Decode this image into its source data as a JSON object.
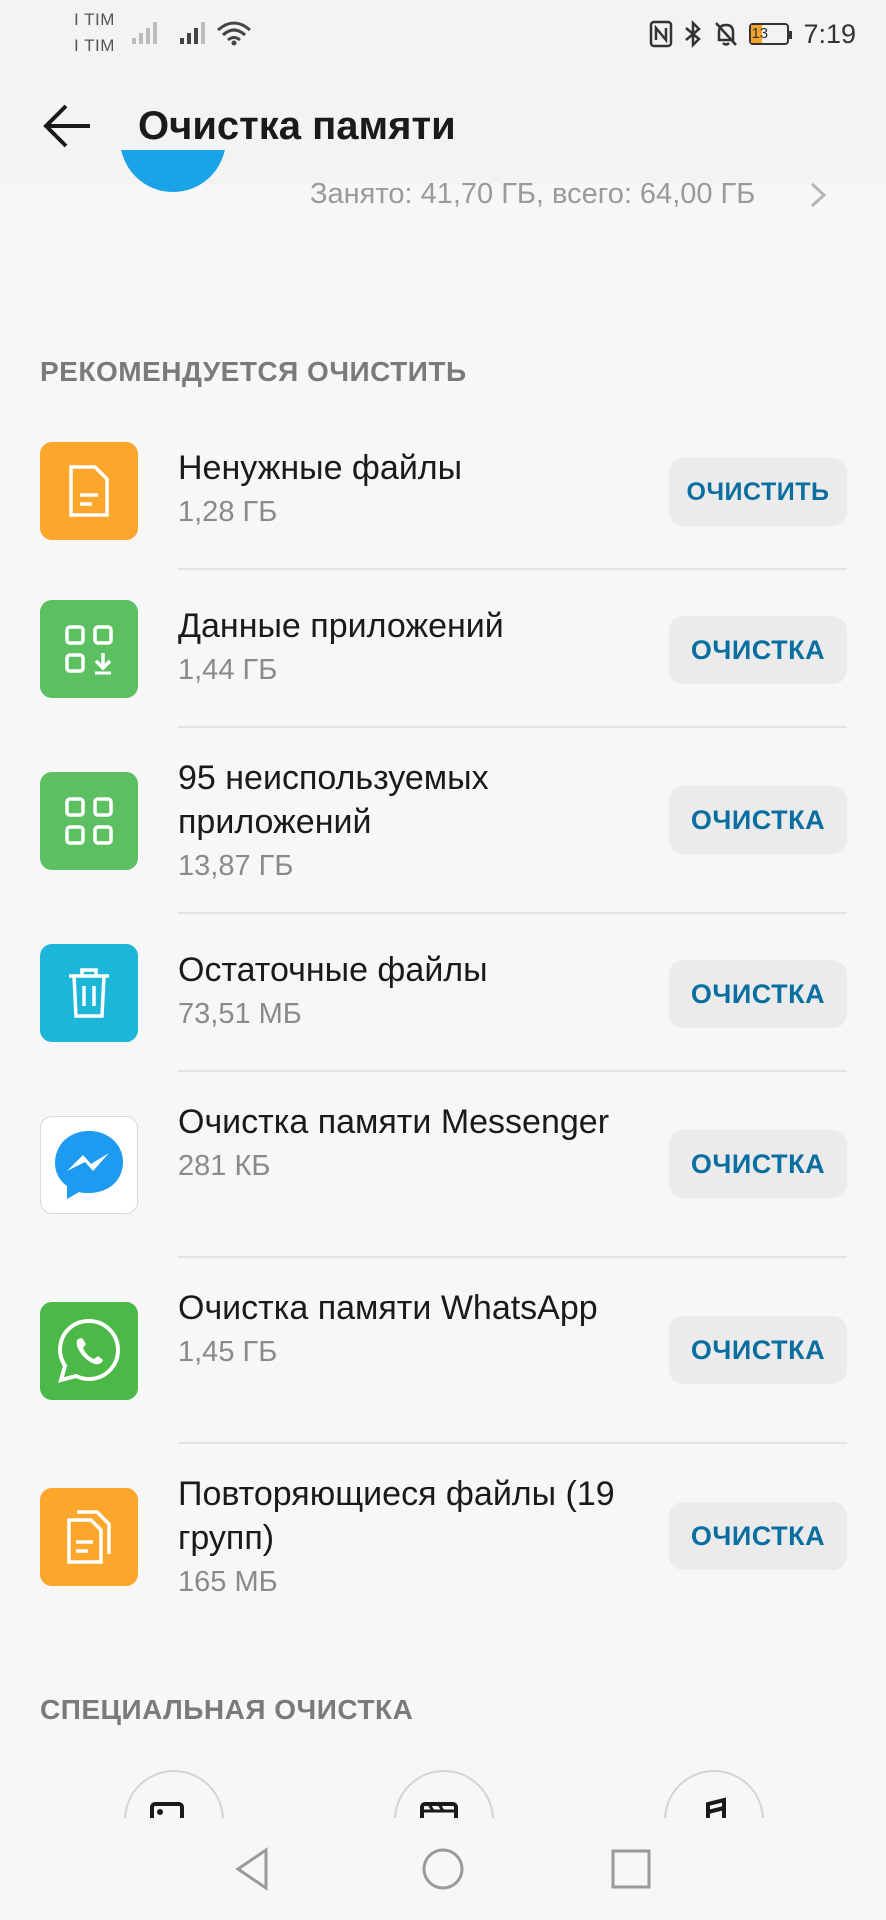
{
  "status_bar": {
    "carrier_1": "I TIM",
    "carrier_2": "I TIM",
    "battery_level": "13",
    "time": "7:19"
  },
  "header": {
    "title": "Очистка памяти"
  },
  "storage": {
    "summary": "Занято: 41,70 ГБ, всего: 64,00 ГБ"
  },
  "recommended": {
    "section_label": "РЕКОМЕНДУЕТСЯ ОЧИСТИТЬ",
    "items": [
      {
        "title": "Ненужные файлы",
        "size": "1,28 ГБ",
        "button": "ОЧИСТИТЬ",
        "icon": "junk-file-icon",
        "color": "#fca62c"
      },
      {
        "title": "Данные приложений",
        "size": "1,44 ГБ",
        "button": "ОЧИСТКА",
        "icon": "app-data-icon",
        "color": "#5cbf62"
      },
      {
        "title": "95 неиспользуемых приложений",
        "size": "13,87 ГБ",
        "button": "ОЧИСТКА",
        "icon": "unused-apps-icon",
        "color": "#5cbf62"
      },
      {
        "title": "Остаточные файлы",
        "size": "73,51 МБ",
        "button": "ОЧИСТКА",
        "icon": "trash-icon",
        "color": "#1cb6d8"
      },
      {
        "title": "Очистка памяти Messenger",
        "size": "281 КБ",
        "button": "ОЧИСТКА",
        "icon": "messenger-icon",
        "color": "#ffffff"
      },
      {
        "title": "Очистка памяти WhatsApp",
        "size": "1,45 ГБ",
        "button": "ОЧИСТКА",
        "icon": "whatsapp-icon",
        "color": "#4cb848"
      },
      {
        "title": "Повторяющиеся файлы (19 групп)",
        "size": "165 МБ",
        "button": "ОЧИСТКА",
        "icon": "duplicate-files-icon",
        "color": "#fca62c"
      }
    ]
  },
  "special": {
    "section_label": "СПЕЦИАЛЬНАЯ ОЧИСТКА"
  },
  "colors": {
    "accent": "#0a6fa0",
    "storage_ring": "#1aa3e6"
  }
}
